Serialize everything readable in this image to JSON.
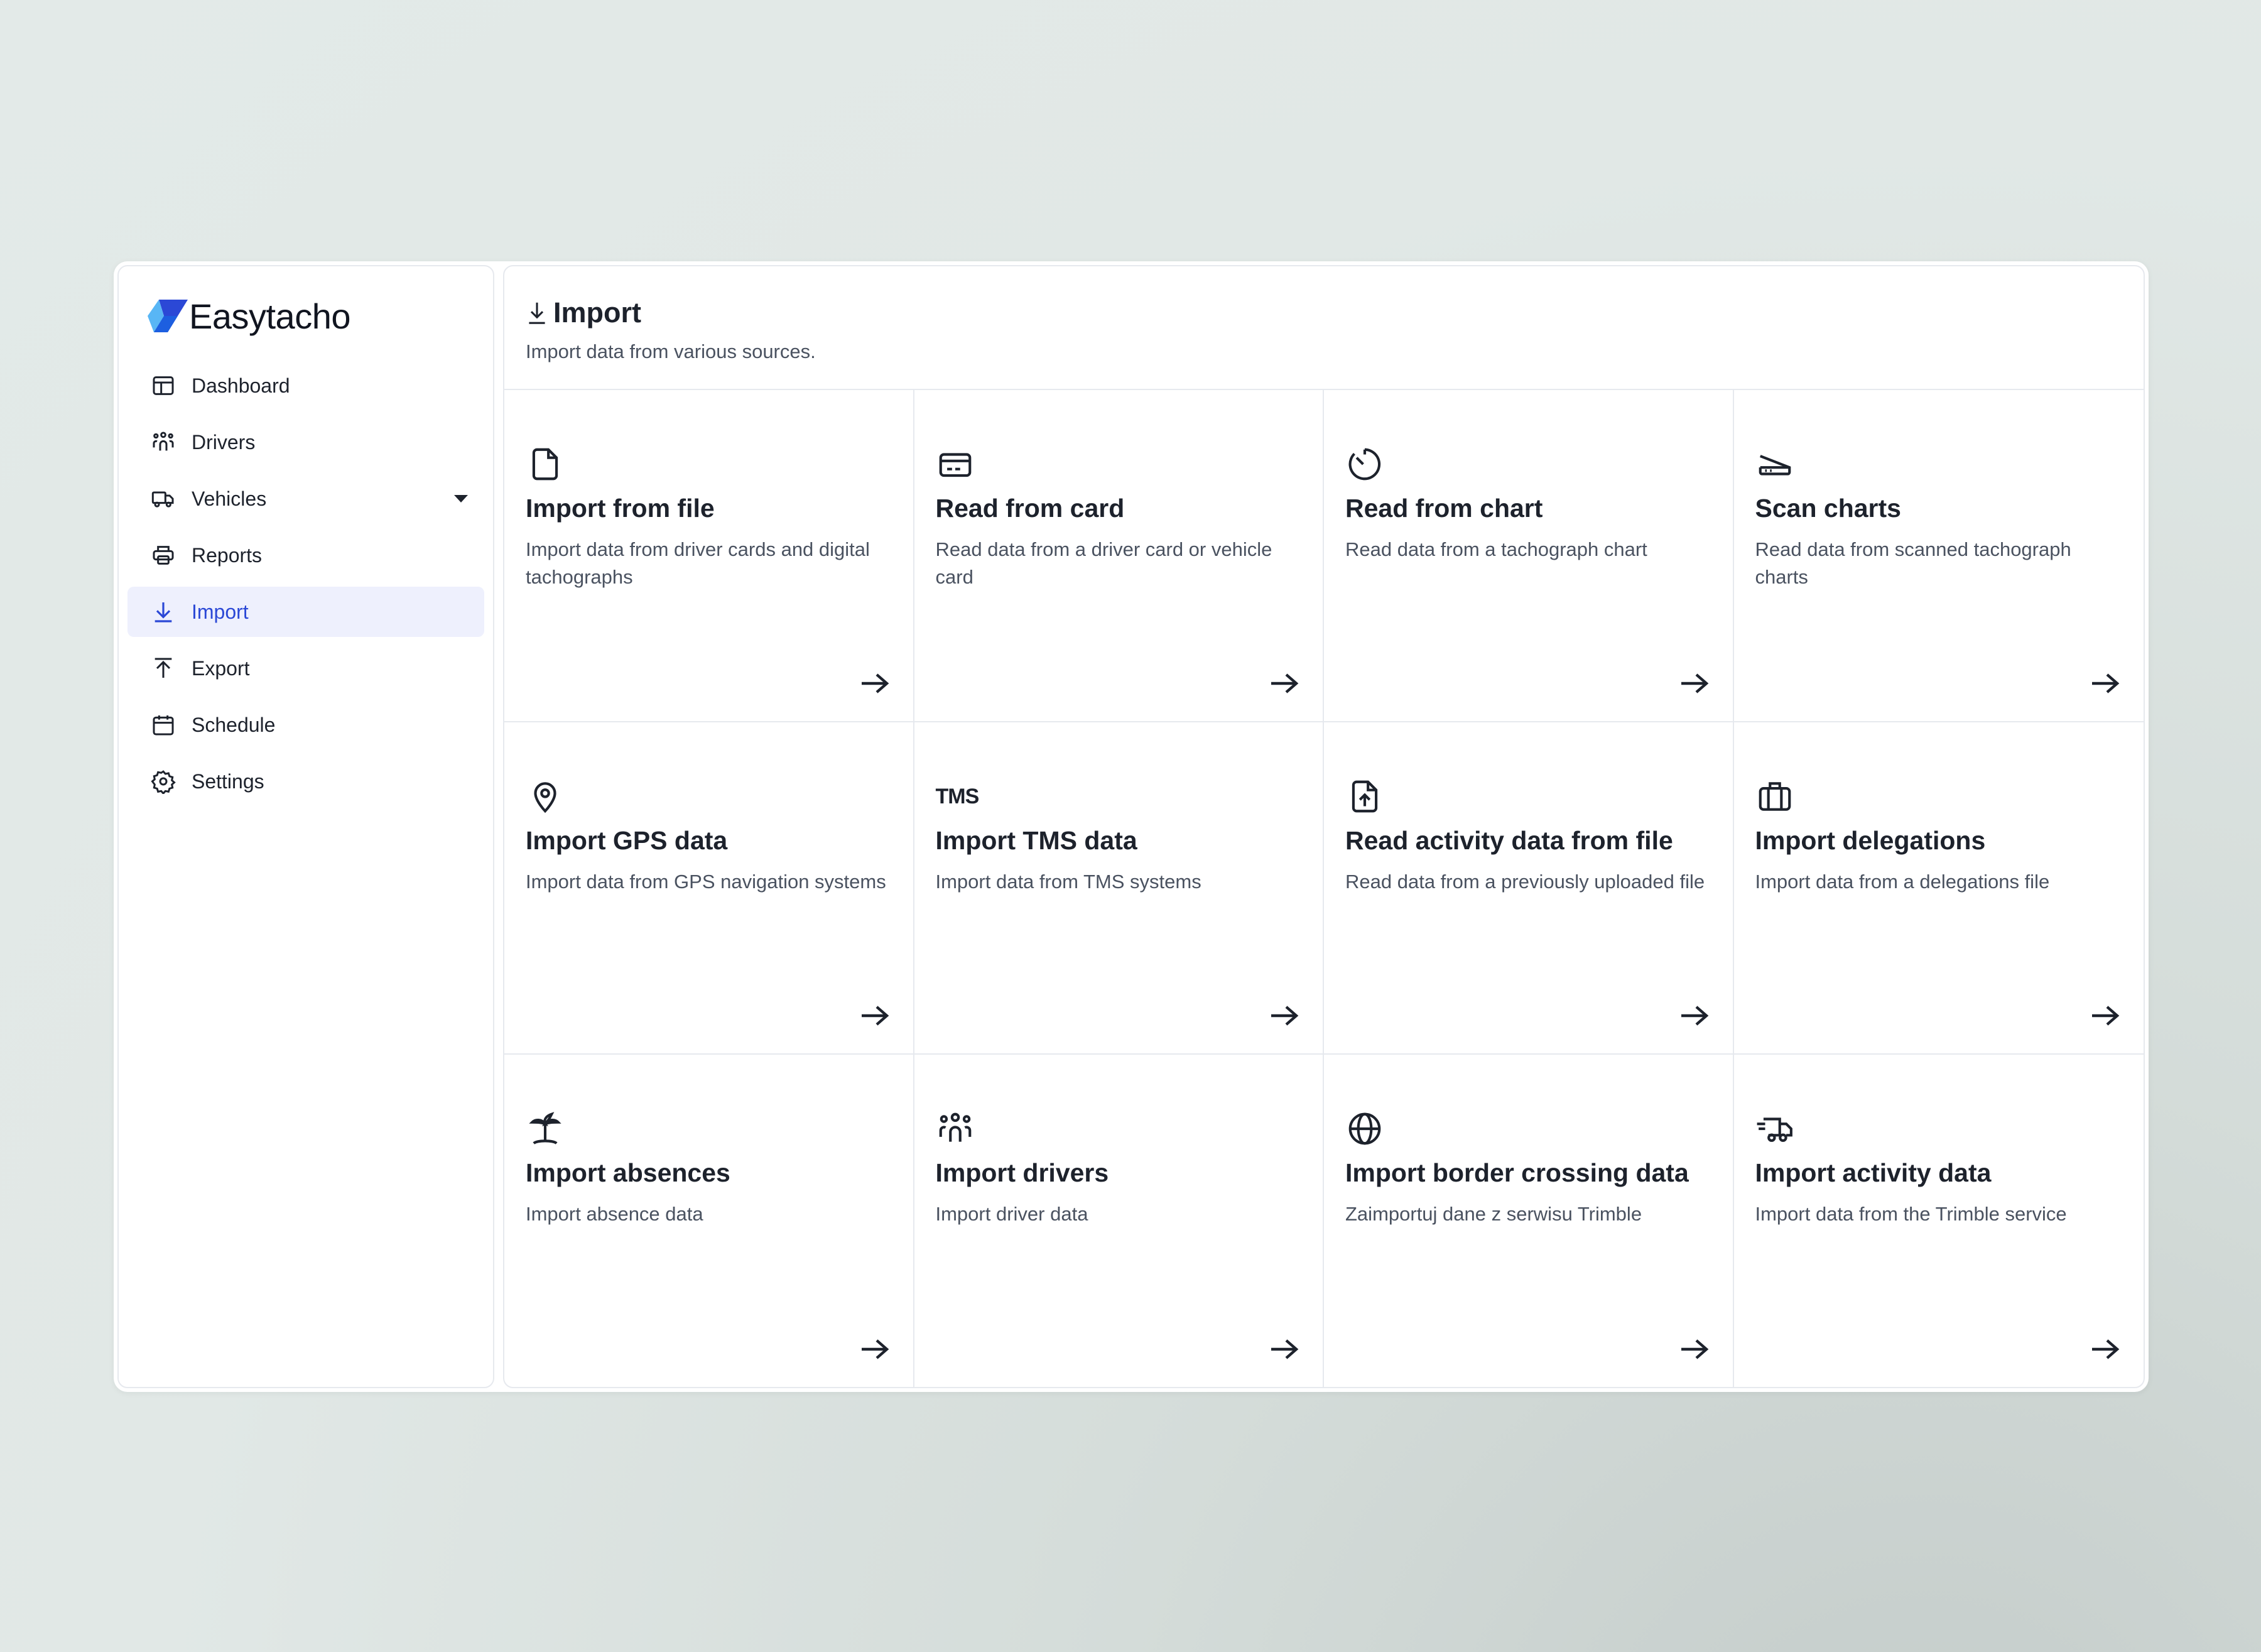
{
  "app": {
    "brand": "Easytacho"
  },
  "sidebar": {
    "items": [
      {
        "label": "Dashboard",
        "icon": "layout-icon"
      },
      {
        "label": "Drivers",
        "icon": "users-icon"
      },
      {
        "label": "Vehicles",
        "icon": "truck-icon",
        "has_dropdown": true
      },
      {
        "label": "Reports",
        "icon": "printer-icon"
      },
      {
        "label": "Import",
        "icon": "download-icon",
        "active": true
      },
      {
        "label": "Export",
        "icon": "upload-icon"
      },
      {
        "label": "Schedule",
        "icon": "calendar-icon"
      },
      {
        "label": "Settings",
        "icon": "gear-icon"
      }
    ]
  },
  "header": {
    "title": "Import",
    "subtitle": "Import data from various sources."
  },
  "cards": [
    {
      "title": "Import from file",
      "description": "Import data from driver cards and digital tachographs",
      "icon": "file-icon"
    },
    {
      "title": "Read from card",
      "description": "Read data from a driver card or vehicle card",
      "icon": "card-icon"
    },
    {
      "title": "Read from chart",
      "description": "Read data from a tachograph chart",
      "icon": "chart-dial-icon"
    },
    {
      "title": "Scan charts",
      "description": "Read data from scanned tachograph charts",
      "icon": "scanner-icon"
    },
    {
      "title": "Import GPS data",
      "description": "Import data from GPS navigation systems",
      "icon": "map-pin-icon"
    },
    {
      "title": "Import TMS data",
      "description": "Import data from TMS systems",
      "icon": "tms-icon",
      "icon_text": "TMS"
    },
    {
      "title": "Read activity data from file",
      "description": "Read data from a previously uploaded file",
      "icon": "file-upload-icon"
    },
    {
      "title": "Import delegations",
      "description": "Import data from a delegations file",
      "icon": "briefcase-icon"
    },
    {
      "title": "Import absences",
      "description": "Import absence data",
      "icon": "palm-tree-icon"
    },
    {
      "title": "Import drivers",
      "description": "Import driver data",
      "icon": "users-icon"
    },
    {
      "title": "Import border crossing data",
      "description": "Zaimportuj dane z serwisu Trimble",
      "icon": "globe-icon"
    },
    {
      "title": "Import activity data",
      "description": "Import data from the Trimble service",
      "icon": "truck-fast-icon"
    }
  ],
  "colors": {
    "accent": "#2b48d6",
    "active_bg": "#eef0fd",
    "text": "#1d222c",
    "muted": "#4a5260"
  }
}
